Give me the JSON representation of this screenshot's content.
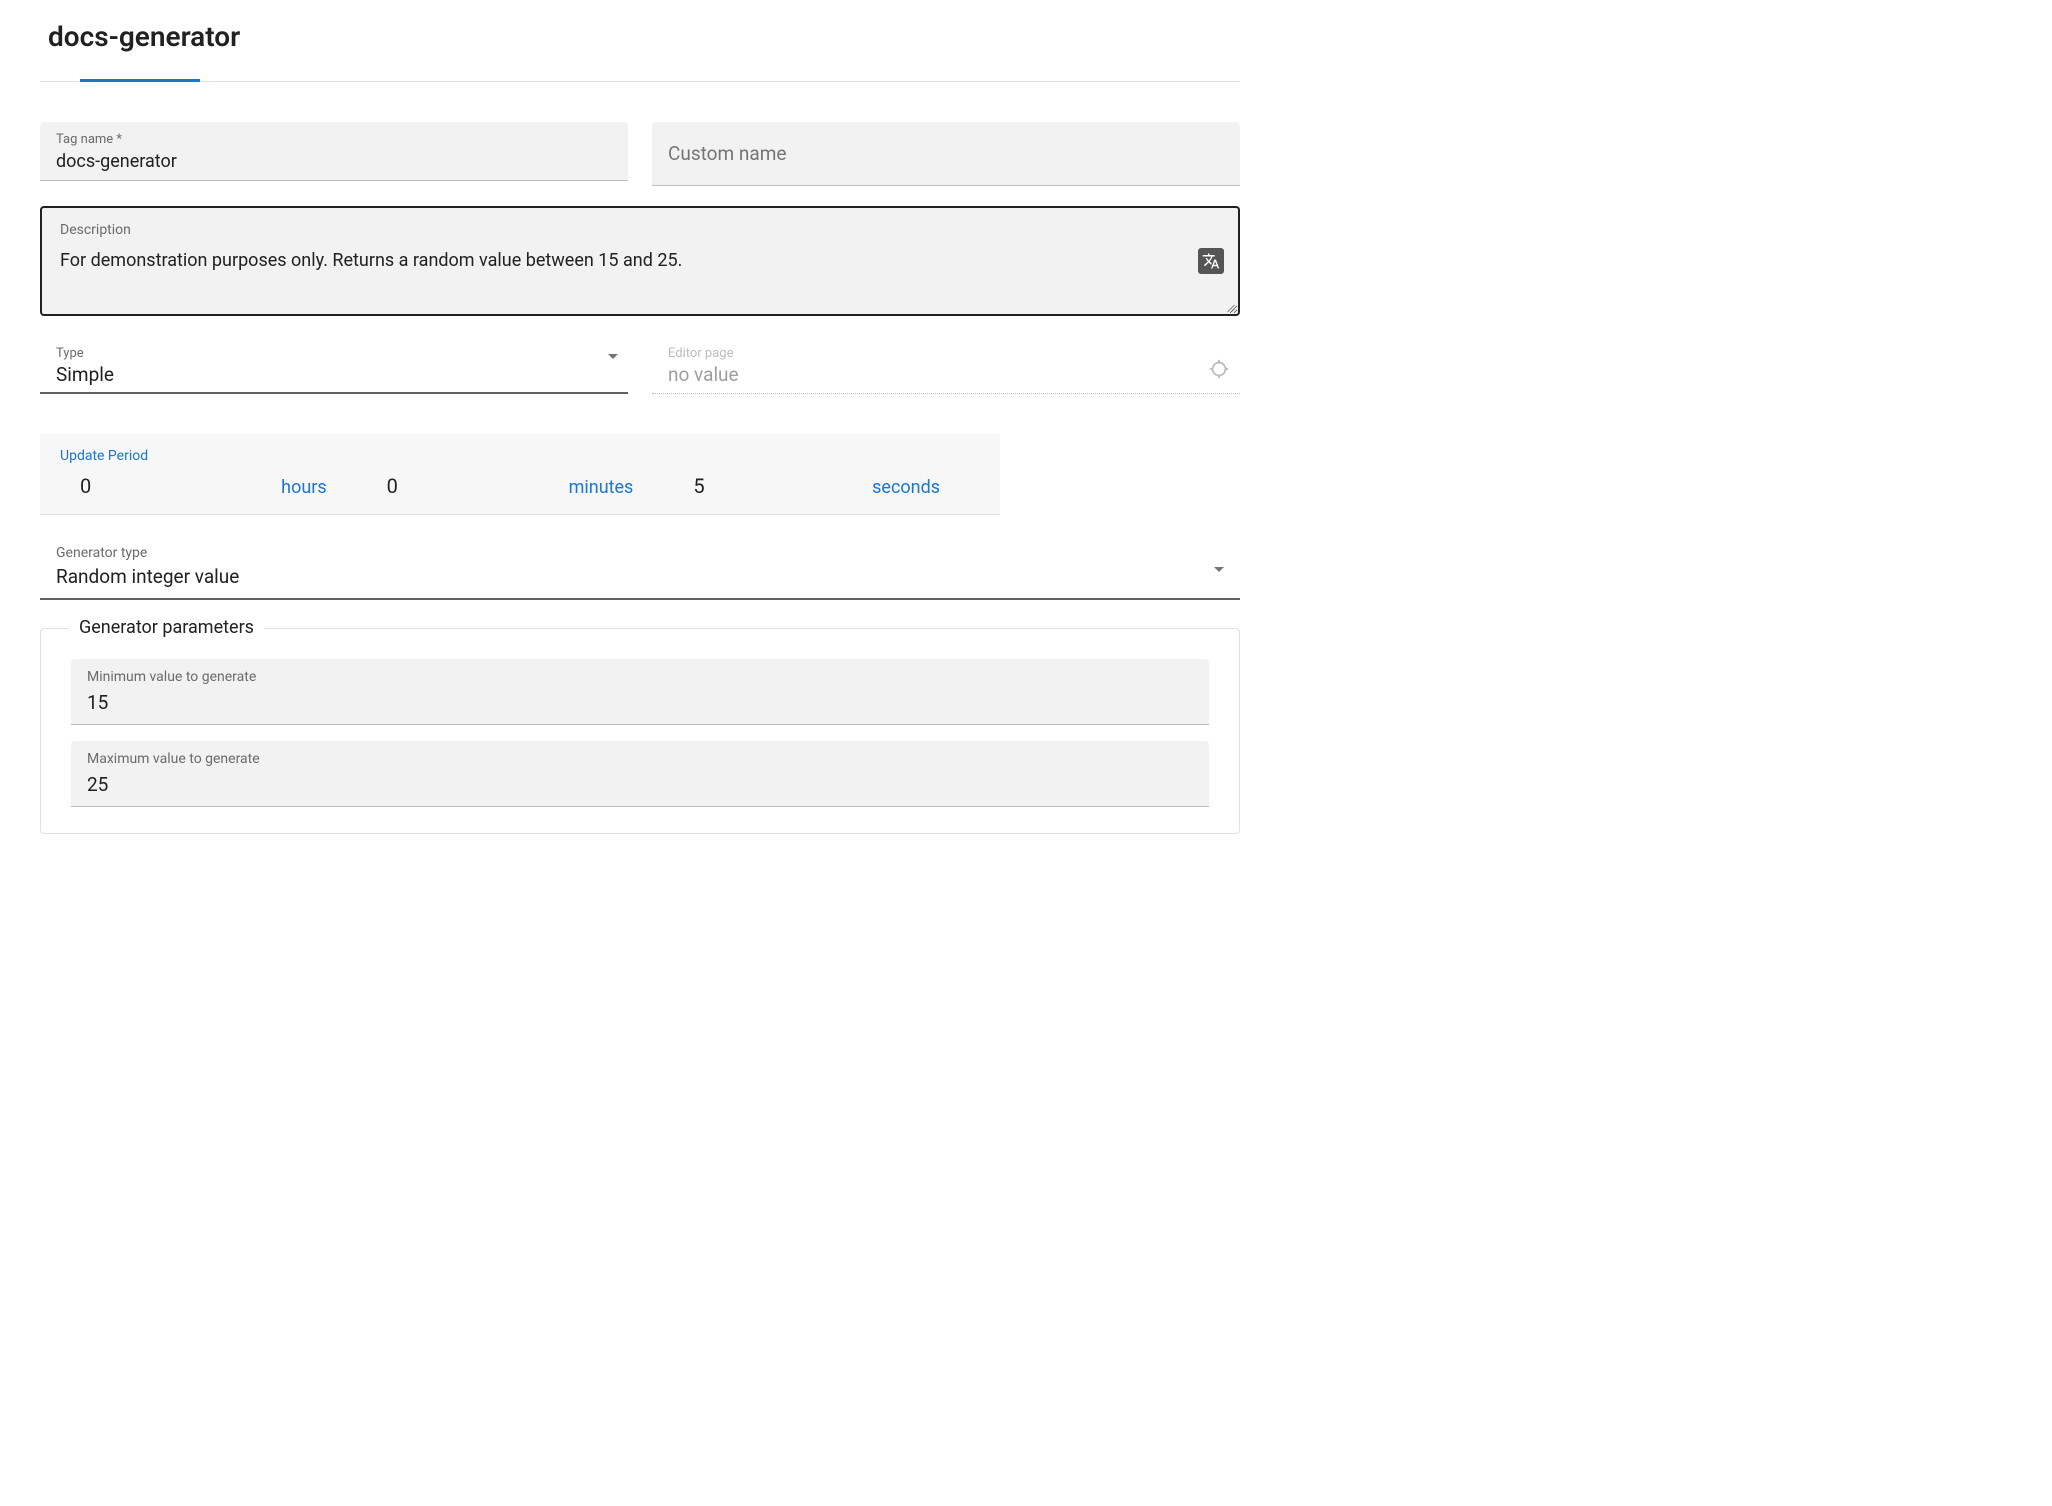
{
  "page_title": "docs-generator",
  "tag_name": {
    "label": "Tag name *",
    "value": "docs-generator"
  },
  "custom_name": {
    "placeholder": "Custom name"
  },
  "description": {
    "label": "Description",
    "value": "For demonstration purposes only. Returns a random value between 15 and 25."
  },
  "type": {
    "label": "Type",
    "value": "Simple"
  },
  "editor_page": {
    "label": "Editor page",
    "value": "no value"
  },
  "update_period": {
    "label": "Update Period",
    "hours": {
      "value": "0",
      "unit": "hours"
    },
    "minutes": {
      "value": "0",
      "unit": "minutes"
    },
    "seconds": {
      "value": "5",
      "unit": "seconds"
    }
  },
  "generator_type": {
    "label": "Generator type",
    "value": "Random integer value"
  },
  "generator_params": {
    "legend": "Generator parameters",
    "min": {
      "label": "Minimum value to generate",
      "value": "15"
    },
    "max": {
      "label": "Maximum value to generate",
      "value": "25"
    }
  }
}
